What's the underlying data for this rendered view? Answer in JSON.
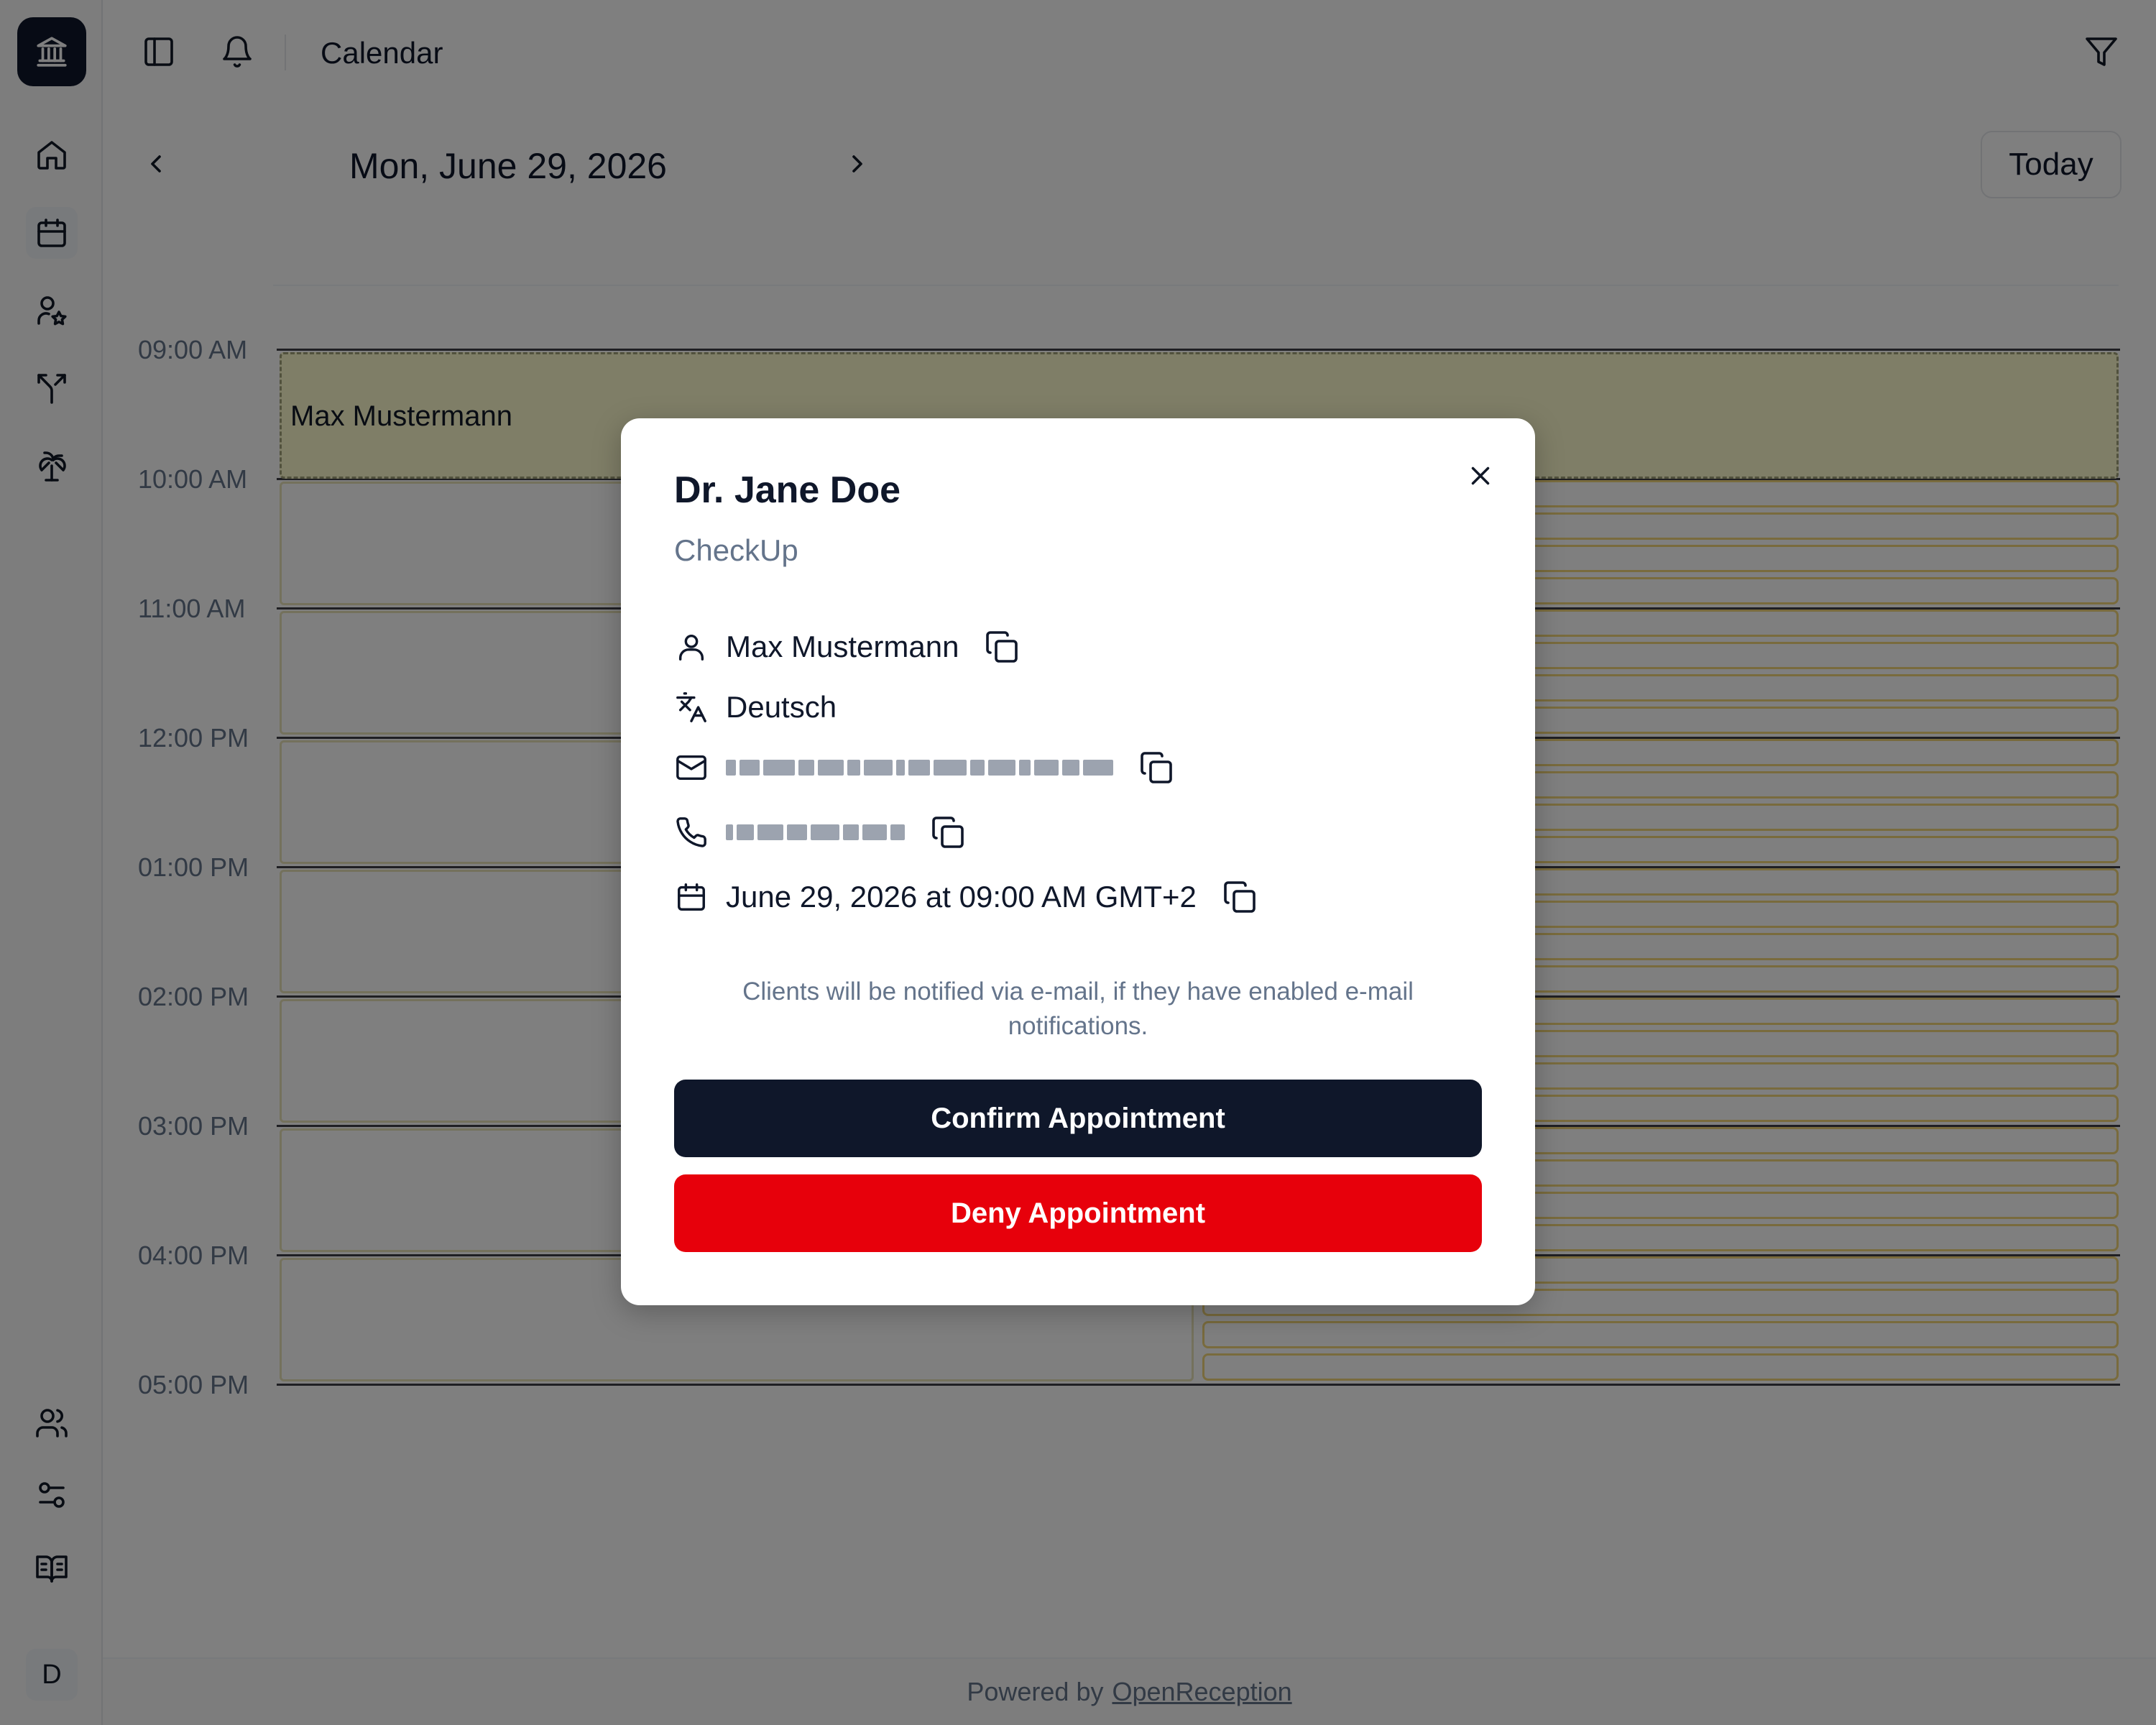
{
  "header": {
    "title": "Calendar"
  },
  "date_nav": {
    "date": "Mon, June 29, 2026",
    "today_label": "Today"
  },
  "calendar": {
    "hours": [
      "09:00 AM",
      "10:00 AM",
      "11:00 AM",
      "12:00 PM",
      "01:00 PM",
      "02:00 PM",
      "03:00 PM",
      "04:00 PM",
      "05:00 PM"
    ],
    "event_name": "Max Mustermann"
  },
  "footer": {
    "prefix": "Powered by",
    "link": "OpenReception"
  },
  "user": {
    "initial": "D"
  },
  "modal": {
    "title": "Dr. Jane Doe",
    "subtitle": "CheckUp",
    "client_name": "Max Mustermann",
    "language": "Deutsch",
    "datetime": "June 29, 2026 at 09:00 AM GMT+2",
    "note": "Clients will be notified via e-mail, if they have enabled e-mail notifications.",
    "confirm_label": "Confirm Appointment",
    "deny_label": "Deny Appointment"
  },
  "colors": {
    "primary": "#0f172a",
    "danger": "#e7000b",
    "muted": "#64748b"
  }
}
